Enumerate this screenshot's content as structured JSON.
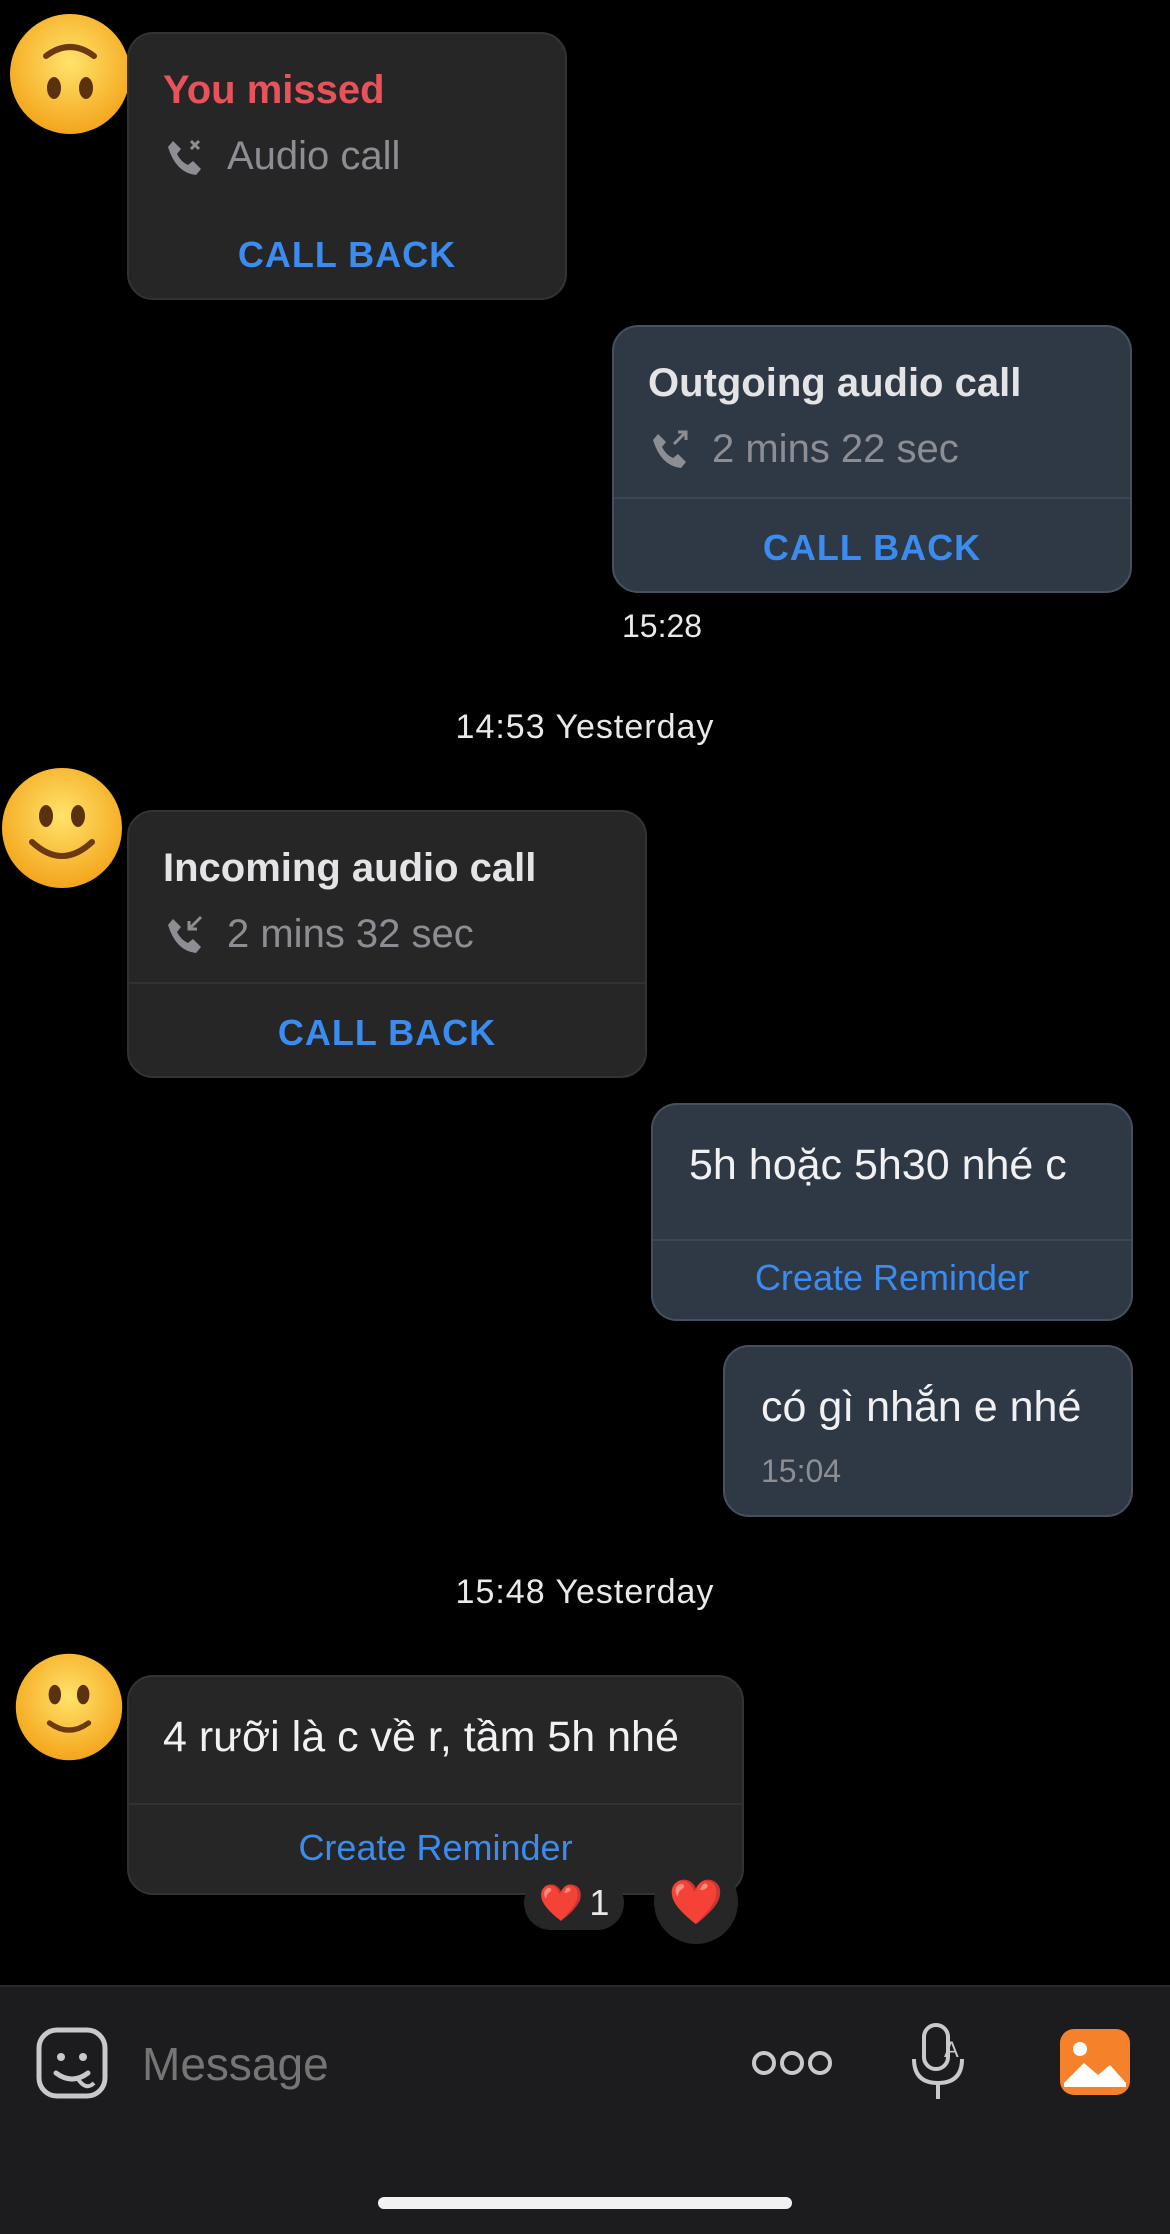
{
  "messages": {
    "missed_call": {
      "title": "You missed",
      "subtitle": "Audio call",
      "action": "CALL BACK"
    },
    "outgoing_call": {
      "title": "Outgoing audio call",
      "duration": "2 mins 22 sec",
      "action": "CALL BACK",
      "time": "15:28"
    },
    "separator_1": "14:53 Yesterday",
    "incoming_call": {
      "title": "Incoming audio call",
      "duration": "2 mins 32 sec",
      "action": "CALL BACK"
    },
    "out_msg_1": {
      "text": "5h hoặc 5h30 nhé c",
      "action": "Create Reminder"
    },
    "out_msg_2": {
      "text": "có gì nhắn e nhé",
      "time": "15:04"
    },
    "separator_2": "15:48 Yesterday",
    "in_msg_1": {
      "text": "4 rưỡi là c về r, tầm 5h nhé",
      "action": "Create Reminder"
    },
    "reaction": {
      "emoji": "❤️",
      "count": "1"
    },
    "quick_reaction": "❤️"
  },
  "composer": {
    "placeholder": "Message"
  },
  "colors": {
    "accent": "#3b8cf0",
    "missed": "#e8525a",
    "gallery": "#f5822a"
  }
}
